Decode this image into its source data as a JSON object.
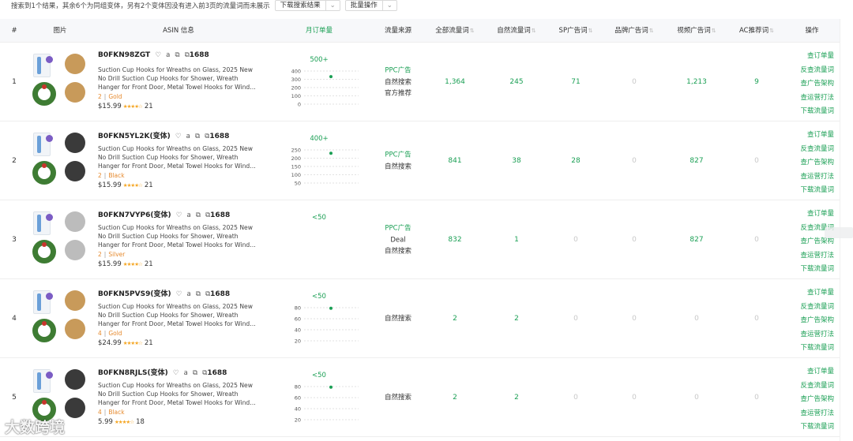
{
  "toolbar": {
    "summary": "搜索到1个结果，其余6个为同组变体，另有2个变体因没有进入前3页的流量词而未展示",
    "download_label": "下载搜索结果",
    "batch_label": "批量操作"
  },
  "columns": {
    "index": "#",
    "image": "图片",
    "asin": "ASIN 信息",
    "monthly_orders": "月订单量",
    "traffic_source": "流量来源",
    "all_keywords": "全部流量词",
    "organic_keywords": "自然流量词",
    "sp_keywords": "SP广告词",
    "brand_keywords": "品牌广告词",
    "video_keywords": "视频广告词",
    "ac_keywords": "AC推荐词",
    "actions": "操作"
  },
  "actions": [
    "查订单量",
    "反查流量词",
    "查广告架构",
    "查运营打法",
    "下载流量词"
  ],
  "rows": [
    {
      "index": "1",
      "asin": "B0FKN98ZGT",
      "badge": "1688",
      "title_lines": [
        "Suction Cup Hooks for Wreaths on Glass, 2025 New",
        "No Drill Suction Cup Hooks for Shower, Wreath",
        "Hanger for Front Door, Metal Towel Hooks for Windo..."
      ],
      "variant_count": "2",
      "variant_color": "Gold",
      "hook_color": "#c89a5a",
      "price": "$15.99",
      "reviews": "21",
      "sales_label": "500+",
      "sales_ticks": [
        "400",
        "300",
        "200",
        "100",
        "0"
      ],
      "sales_level": 0.83,
      "sources": [
        "PPC广告",
        "自然搜索",
        "官方推荐"
      ],
      "all_kw": "1,364",
      "organic_kw": "245",
      "sp_kw": "71",
      "brand_kw": "0",
      "video_kw": "1,213",
      "ac_kw": "9"
    },
    {
      "index": "2",
      "asin": "B0FKN5YL2K(变体)",
      "badge": "1688",
      "title_lines": [
        "Suction Cup Hooks for Wreaths on Glass, 2025 New",
        "No Drill Suction Cup Hooks for Shower, Wreath",
        "Hanger for Front Door, Metal Towel Hooks for Windo..."
      ],
      "variant_count": "2",
      "variant_color": "Black",
      "hook_color": "#3a3a3a",
      "price": "$15.99",
      "reviews": "21",
      "sales_label": "400+",
      "sales_ticks": [
        "250",
        "200",
        "150",
        "100",
        "50"
      ],
      "sales_level": 0.9,
      "sources": [
        "PPC广告",
        "自然搜索"
      ],
      "all_kw": "841",
      "organic_kw": "38",
      "sp_kw": "28",
      "brand_kw": "0",
      "video_kw": "827",
      "ac_kw": "0"
    },
    {
      "index": "3",
      "asin": "B0FKN7VYP6(变体)",
      "badge": "1688",
      "title_lines": [
        "Suction Cup Hooks for Wreaths on Glass, 2025 New",
        "No Drill Suction Cup Hooks for Shower, Wreath",
        "Hanger for Front Door, Metal Towel Hooks for Windo..."
      ],
      "variant_count": "2",
      "variant_color": "Silver",
      "hook_color": "#bcbcbc",
      "price": "$15.99",
      "reviews": "21",
      "sales_label": "<50",
      "sales_ticks": [],
      "sales_level": null,
      "sources": [
        "PPC广告",
        "Deal",
        "自然搜索"
      ],
      "all_kw": "832",
      "organic_kw": "1",
      "sp_kw": "0",
      "brand_kw": "0",
      "video_kw": "827",
      "ac_kw": "0"
    },
    {
      "index": "4",
      "asin": "B0FKN5PVS9(变体)",
      "badge": "1688",
      "title_lines": [
        "Suction Cup Hooks for Wreaths on Glass, 2025 New",
        "No Drill Suction Cup Hooks for Shower, Wreath",
        "Hanger for Front Door, Metal Towel Hooks for Windo..."
      ],
      "variant_count": "4",
      "variant_color": "Gold",
      "hook_color": "#c89a5a",
      "price": "$24.99",
      "reviews": "21",
      "sales_label": "<50",
      "sales_ticks": [
        "80",
        "60",
        "40",
        "20"
      ],
      "sales_level": 0.98,
      "sources": [
        "自然搜索"
      ],
      "all_kw": "2",
      "organic_kw": "2",
      "sp_kw": "0",
      "brand_kw": "0",
      "video_kw": "0",
      "ac_kw": "0"
    },
    {
      "index": "5",
      "asin": "B0FKN8RJLS(变体)",
      "badge": "1688",
      "title_lines": [
        "Suction Cup Hooks for Wreaths on Glass, 2025 New",
        "No Drill Suction Cup Hooks for Shower, Wreath",
        "Hanger for Front Door, Metal Towel Hooks for Windo..."
      ],
      "variant_count": "4",
      "variant_color": "Black",
      "hook_color": "#3a3a3a",
      "price": "5.99",
      "reviews": "18",
      "sales_label": "<50",
      "sales_ticks": [
        "80",
        "60",
        "40",
        "20"
      ],
      "sales_level": 0.98,
      "sources": [
        "自然搜索"
      ],
      "all_kw": "2",
      "organic_kw": "2",
      "sp_kw": "0",
      "brand_kw": "0",
      "video_kw": "0",
      "ac_kw": "0"
    }
  ],
  "watermark": "大数跨境"
}
